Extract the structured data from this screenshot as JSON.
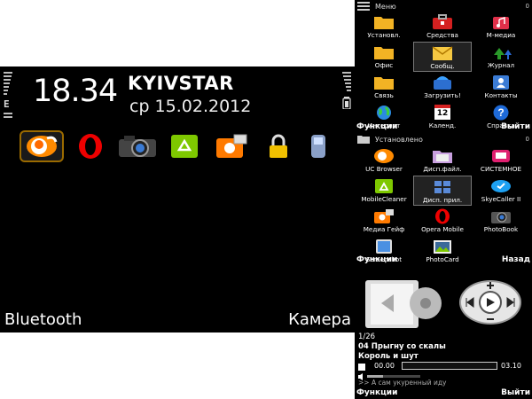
{
  "home": {
    "time": "18.34",
    "operator": "KYIVSTAR",
    "date": "ср 15.02.2012",
    "network_letter": "E",
    "dock_icons": [
      "uc-browser-icon",
      "opera-icon",
      "camera-icon",
      "recycle-icon",
      "media-gallery-icon",
      "lock-icon",
      "phone-handset-icon"
    ],
    "softkey_left": "Bluetooth",
    "softkey_right": "Камера"
  },
  "menu": {
    "title": "Меню",
    "count": "0",
    "items": [
      {
        "label": "Установл.",
        "icon": "folder-apps-icon"
      },
      {
        "label": "Средства",
        "icon": "toolbox-icon"
      },
      {
        "label": "М-медиа",
        "icon": "music-note-icon"
      },
      {
        "label": "Офис",
        "icon": "folder-office-icon"
      },
      {
        "label": "Сообщ.",
        "icon": "envelope-icon"
      },
      {
        "label": "Журнал",
        "icon": "arrows-log-icon"
      },
      {
        "label": "Связь",
        "icon": "folder-connectivity-icon"
      },
      {
        "label": "Загрузить!",
        "icon": "download-shop-icon"
      },
      {
        "label": "Контакты",
        "icon": "contacts-icon"
      },
      {
        "label": "Интернет",
        "icon": "globe-icon"
      },
      {
        "label": "Календ.",
        "icon": "calendar-icon"
      },
      {
        "label": "Справка",
        "icon": "help-icon"
      }
    ],
    "calendar_day": "12",
    "softkey_left": "Функции",
    "softkey_right": "Выйти"
  },
  "installed": {
    "title": "Установлено",
    "count": "0",
    "items": [
      {
        "label": "UC Browser",
        "icon": "uc-browser-icon"
      },
      {
        "label": "Дисп.файл.",
        "icon": "file-manager-icon"
      },
      {
        "label": "СИСТЕМНОЕ",
        "icon": "system-icon"
      },
      {
        "label": "MobileCleaner",
        "icon": "recycle-icon"
      },
      {
        "label": "Дисп. прил.",
        "icon": "app-manager-icon"
      },
      {
        "label": "SkyeCaller II",
        "icon": "skype-icon"
      },
      {
        "label": "Медиа Гейф",
        "icon": "media-gallery-icon"
      },
      {
        "label": "Opera Mobile",
        "icon": "opera-icon"
      },
      {
        "label": "PhotoBook",
        "icon": "camera-icon"
      },
      {
        "label": "Screenshot",
        "icon": "screenshot-icon"
      },
      {
        "label": "PhotoCard",
        "icon": "photocard-icon"
      }
    ],
    "softkey_left": "Функции",
    "softkey_right": "Назад"
  },
  "player": {
    "track_index": "1/26",
    "track_title": "04 Прыгну со скалы",
    "artist": "Король и шут",
    "elapsed": "00.00",
    "total": "03.10",
    "progress": 0,
    "volume": 0.3,
    "next_up": ">> А сам укуренный иду",
    "softkey_left": "Функции",
    "softkey_right": "Выйти"
  },
  "colors": {
    "background": "#000000",
    "selection_border": "#9a6a00"
  }
}
